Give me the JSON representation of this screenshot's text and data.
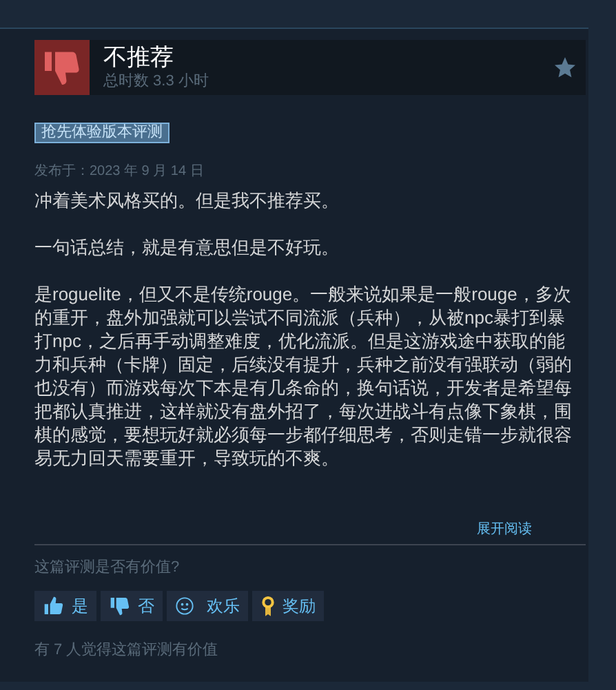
{
  "review": {
    "verdict": "不推荐",
    "recommended": false,
    "playtime": "总时数 3.3 小时",
    "badge": "抢先体验版本评测",
    "posted": "发布于：2023 年 9 月 14 日",
    "paragraphs": [
      "冲着美术风格买的。但是我不推荐买。",
      "一句话总结，就是有意思但是不好玩。",
      "是roguelite，但又不是传统rouge。一般来说如果是一般rouge，多次的重开，盘外加强就可以尝试不同流派（兵种），从被npc暴打到暴打npc，之后再手动调整难度，优化流派。但是这游戏途中获取的能力和兵种（卡牌）固定，后续没有提升，兵种之前没有强联动（弱的也没有）而游戏每次下本是有几条命的，换句话说，开发者是希望每把都认真推进，这样就没有盘外招了，每次进战斗有点像下象棋，围棋的感觉，要想玩好就必须每一步都仔细思考，否则走错一步就很容易无力回天需要重开，导致玩的不爽。"
    ],
    "expand": "展开阅读"
  },
  "helpful": {
    "question": "这篇评测是否有价值?",
    "buttons": [
      {
        "kind": "yes",
        "label": "是"
      },
      {
        "kind": "no",
        "label": "否"
      },
      {
        "kind": "funny",
        "label": "欢乐"
      },
      {
        "kind": "award",
        "label": "奖励"
      }
    ],
    "summary": "有 7 人觉得这篇评测有价值"
  }
}
